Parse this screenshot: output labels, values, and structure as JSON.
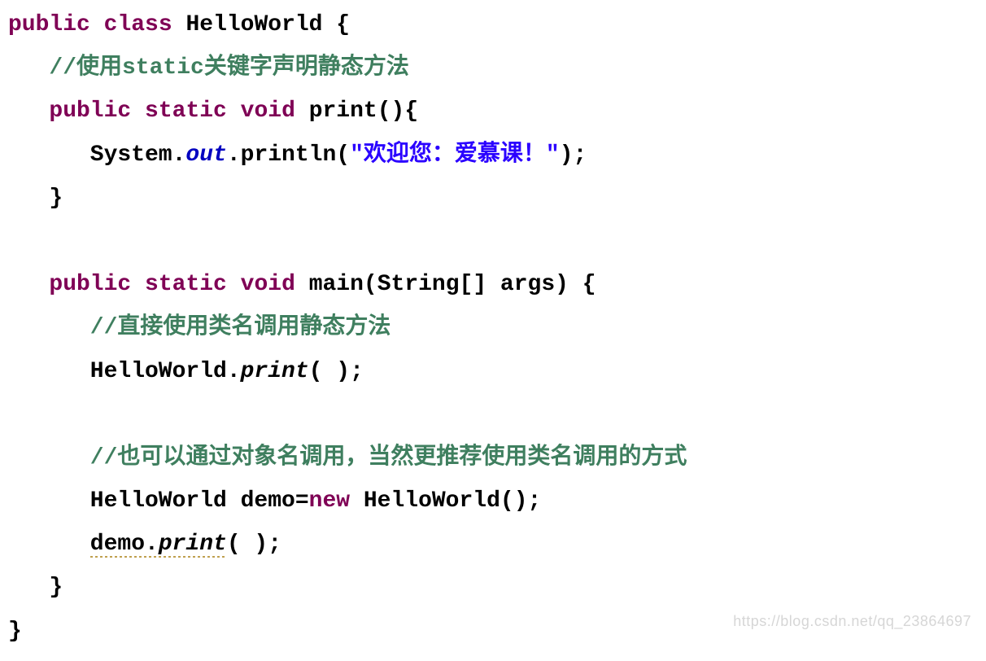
{
  "code": {
    "line1": {
      "kw_public": "public",
      "kw_class": "class",
      "classname": " HelloWorld {"
    },
    "line2_comment": "//使用static关键字声明静态方法",
    "line3": {
      "kw_public": "public",
      "kw_static": "static",
      "kw_void": "void",
      "rest": " print(){"
    },
    "line4": {
      "system": "System.",
      "out": "out",
      "println_open": ".println(",
      "string": "\"欢迎您：爱慕课！\"",
      "close": ");"
    },
    "line5_brace": "}",
    "line6_blank": " ",
    "line7": {
      "kw_public": "public",
      "kw_static": "static",
      "kw_void": "void",
      "rest": " main(String[] args) {"
    },
    "line8_comment": "//直接使用类名调用静态方法",
    "line9": {
      "prefix": "HelloWorld.",
      "call": "print",
      "rest": "( );"
    },
    "line10_blank": " ",
    "line11_comment": "//也可以通过对象名调用，当然更推荐使用类名调用的方式",
    "line12": {
      "prefix": "HelloWorld demo=",
      "kw_new": "new",
      "rest": " HelloWorld();"
    },
    "line13": {
      "prefix": "demo.",
      "call": "print",
      "rest": "( );"
    },
    "line14_brace": "}",
    "line15_brace": "}"
  },
  "watermark": "https://blog.csdn.net/qq_23864697"
}
